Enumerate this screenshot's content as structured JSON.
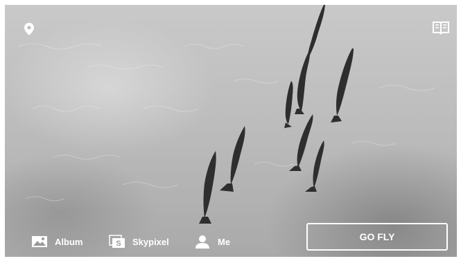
{
  "top_bar": {
    "left_icon": "location-pin-icon",
    "right_icon": "book-icon"
  },
  "nav": {
    "album": {
      "label": "Album",
      "icon": "album-icon"
    },
    "skypixel": {
      "label": "Skypixel",
      "icon": "skypixel-icon"
    },
    "me": {
      "label": "Me",
      "icon": "user-icon"
    }
  },
  "primary_action": {
    "label": "GO FLY"
  }
}
